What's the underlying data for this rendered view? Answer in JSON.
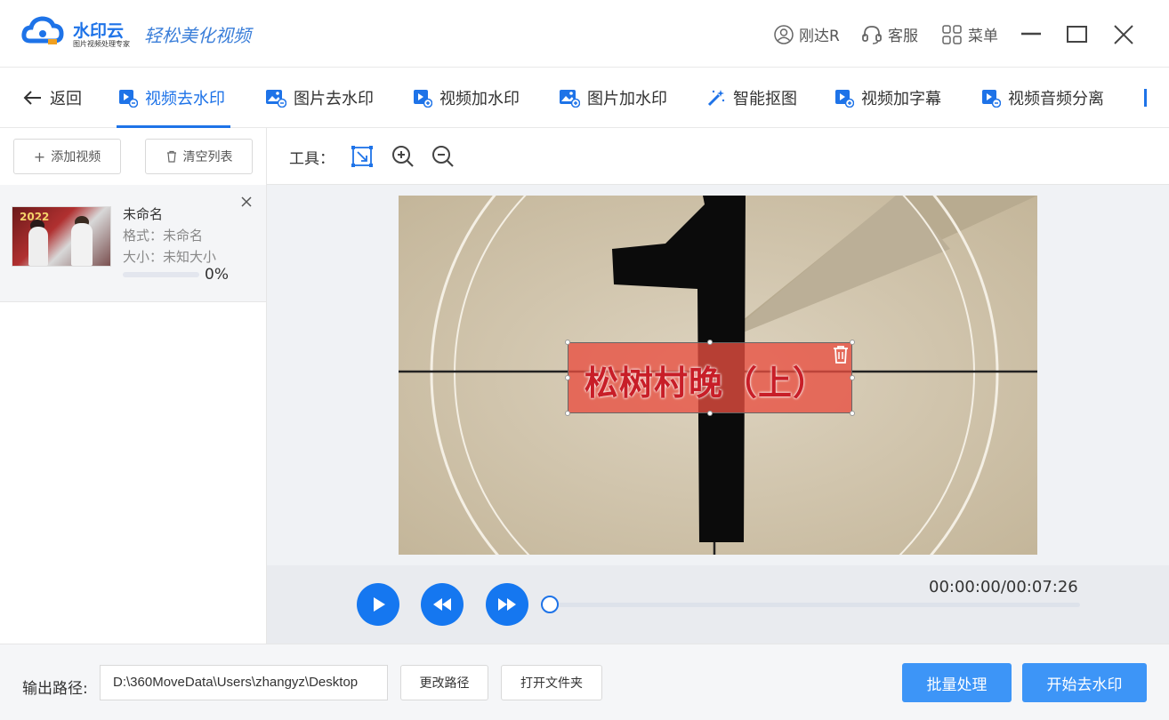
{
  "titlebar": {
    "brand": "水印云",
    "brand_sub": "图片视频处理专家",
    "slogan": "轻松美化视频",
    "user": "刚达R",
    "service": "客服",
    "menu": "菜单"
  },
  "nav": {
    "back": "返回",
    "tabs": [
      "视频去水印",
      "图片去水印",
      "视频加水印",
      "图片加水印",
      "智能抠图",
      "视频加字幕",
      "视频音频分离"
    ],
    "active_index": 0
  },
  "left": {
    "add_button": "添加视频",
    "clear_button": "清空列表",
    "files": [
      {
        "name": "未命名",
        "format": "格式：未命名",
        "size": "大小：未知大小",
        "progress": 0,
        "progress_text": "0%",
        "thumb_text": "2022"
      }
    ]
  },
  "tools": {
    "label": "工具："
  },
  "preview": {
    "watermark_text": "松树村晚（上）"
  },
  "player": {
    "time": "00:00:00/00:07:26",
    "position": 0
  },
  "bottom": {
    "output_label": "输出路径:",
    "output_path": "D:\\360MoveData\\Users\\zhangyz\\Desktop",
    "change_path": "更改路径",
    "open_folder": "打开文件夹",
    "batch": "批量处理",
    "start": "开始去水印"
  },
  "colors": {
    "accent": "#1e73e8",
    "primary_button": "#3d95f7",
    "watermark_box": "#e84e40"
  }
}
